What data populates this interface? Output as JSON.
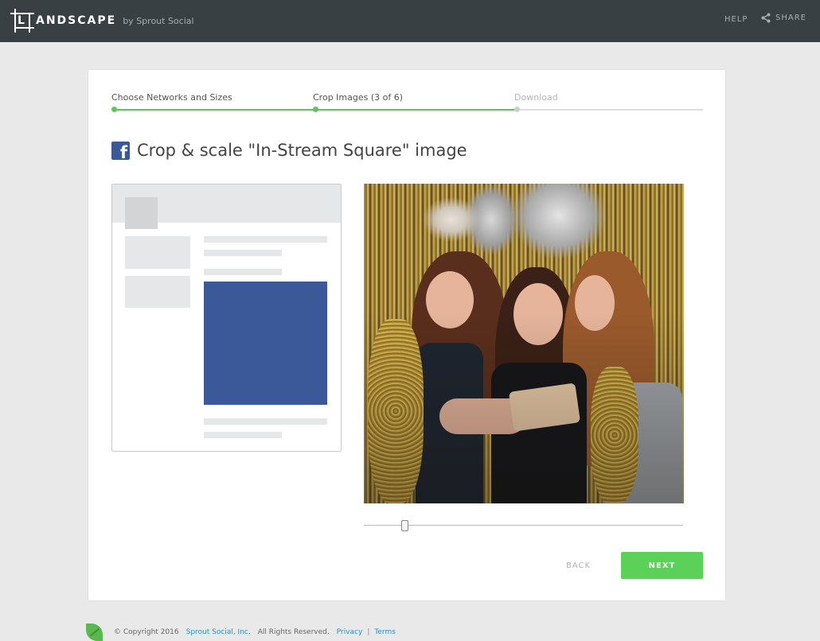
{
  "header": {
    "logo_text": "ANDSCAPE",
    "logo_letter": "L",
    "byline": "by Sprout Social",
    "help_label": "HELP",
    "share_label": "SHARE"
  },
  "steps": [
    {
      "label": "Choose Networks and Sizes",
      "state": "complete"
    },
    {
      "label": "Crop Images (3 of 6)",
      "state": "current"
    },
    {
      "label": "Download",
      "state": "pending"
    }
  ],
  "main": {
    "heading": "Crop & scale \"In-Stream Square\" image",
    "network_icon": "facebook-icon",
    "zoom_slider": 0.12,
    "back_label": "BACK",
    "next_label": "NEXT"
  },
  "colors": {
    "topbar": "#384043",
    "accent_green": "#5bd15a",
    "facebook_blue": "#3b5998",
    "link_blue": "#2b8fc2"
  },
  "footer": {
    "copyright": "© Copyright 2016",
    "company_link": "Sprout Social, Inc.",
    "rights": "All Rights Reserved.",
    "privacy_link": "Privacy",
    "separator": "|",
    "terms_link": "Terms"
  }
}
